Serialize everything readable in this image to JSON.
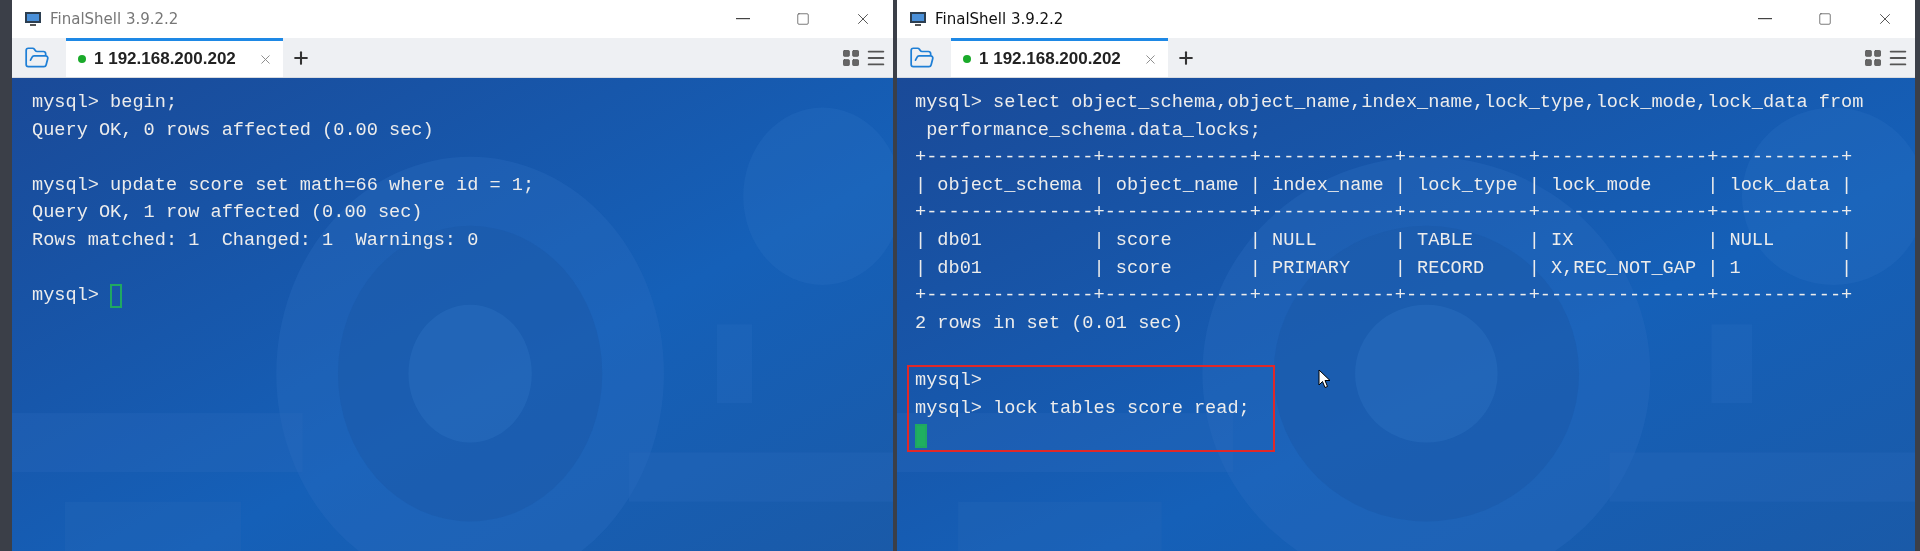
{
  "windows": [
    {
      "title": "FinalShell 3.9.2.2",
      "active": false,
      "tabs": [
        {
          "label": "1 192.168.200.202",
          "selected": true,
          "connected": true
        }
      ],
      "terminal": {
        "focused": false,
        "lines": [
          {
            "kind": "output",
            "text": "mysql> begin;",
            "highlighted": false
          },
          {
            "kind": "output",
            "text": "Query OK, 0 rows affected (0.00 sec)",
            "highlighted": false
          },
          {
            "kind": "blank",
            "highlighted": false
          },
          {
            "kind": "output",
            "text": "mysql> update score set math=66 where id = 1;",
            "highlighted": false
          },
          {
            "kind": "output",
            "text": "Query OK, 1 row affected (0.00 sec)",
            "highlighted": false
          },
          {
            "kind": "output",
            "text": "Rows matched: 1  Changed: 1  Warnings: 0",
            "highlighted": false
          },
          {
            "kind": "blank",
            "highlighted": false
          },
          {
            "kind": "cursor",
            "text": "mysql>",
            "highlighted": false
          }
        ]
      }
    },
    {
      "title": "FinalShell 3.9.2.2",
      "active": true,
      "tabs": [
        {
          "label": "1 192.168.200.202",
          "selected": true,
          "connected": true
        }
      ],
      "terminal": {
        "focused": true,
        "pointer": true,
        "lines": [
          {
            "kind": "output",
            "text": "mysql> select object_schema,object_name,index_name,lock_type,lock_mode,lock_data from",
            "highlighted": false
          },
          {
            "kind": "output",
            "text": " performance_schema.data_locks;",
            "highlighted": false
          },
          {
            "kind": "output",
            "text": "+---------------+-------------+------------+-----------+---------------+-----------+",
            "highlighted": false
          },
          {
            "kind": "output",
            "text": "| object_schema | object_name | index_name | lock_type | lock_mode     | lock_data |",
            "highlighted": false
          },
          {
            "kind": "output",
            "text": "+---------------+-------------+------------+-----------+---------------+-----------+",
            "highlighted": false
          },
          {
            "kind": "output",
            "text": "| db01          | score       | NULL       | TABLE     | IX            | NULL      |",
            "highlighted": false
          },
          {
            "kind": "output",
            "text": "| db01          | score       | PRIMARY    | RECORD    | X,REC_NOT_GAP | 1         |",
            "highlighted": false
          },
          {
            "kind": "output",
            "text": "+---------------+-------------+------------+-----------+---------------+-----------+",
            "highlighted": false
          },
          {
            "kind": "output",
            "text": "2 rows in set (0.01 sec)",
            "highlighted": false
          },
          {
            "kind": "blank",
            "highlighted": false
          },
          {
            "kind": "output",
            "text": "mysql>",
            "highlighted": true
          },
          {
            "kind": "output",
            "text": "mysql> lock tables score read;",
            "highlighted": true
          },
          {
            "kind": "cursor",
            "highlighted": true
          }
        ]
      }
    }
  ]
}
